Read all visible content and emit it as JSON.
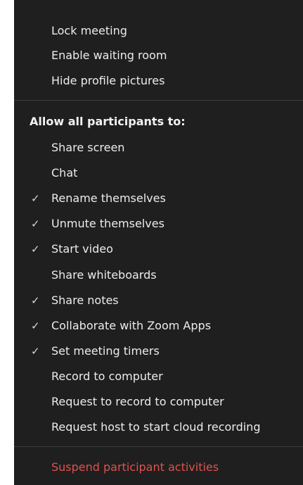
{
  "menu": {
    "top_items": [
      {
        "label": "Lock meeting"
      },
      {
        "label": "Enable waiting room"
      },
      {
        "label": "Hide profile pictures"
      }
    ],
    "section_heading": "Allow all participants to:",
    "check_glyph": "✓",
    "allow_items": [
      {
        "label": "Share screen",
        "checked": false
      },
      {
        "label": "Chat",
        "checked": false
      },
      {
        "label": "Rename themselves",
        "checked": true
      },
      {
        "label": "Unmute themselves",
        "checked": true
      },
      {
        "label": "Start video",
        "checked": true
      },
      {
        "label": "Share whiteboards",
        "checked": false
      },
      {
        "label": "Share notes",
        "checked": true
      },
      {
        "label": "Collaborate with Zoom Apps",
        "checked": true
      },
      {
        "label": "Set meeting timers",
        "checked": true
      },
      {
        "label": "Record to computer",
        "checked": false
      },
      {
        "label": "Request to record to computer",
        "checked": false
      },
      {
        "label": "Request host to start cloud recording",
        "checked": false
      }
    ],
    "suspend_label": "Suspend participant activities",
    "colors": {
      "background": "#1f1f1f",
      "text": "#ececec",
      "divider": "#3c3c3c",
      "danger": "#e0504d"
    }
  }
}
